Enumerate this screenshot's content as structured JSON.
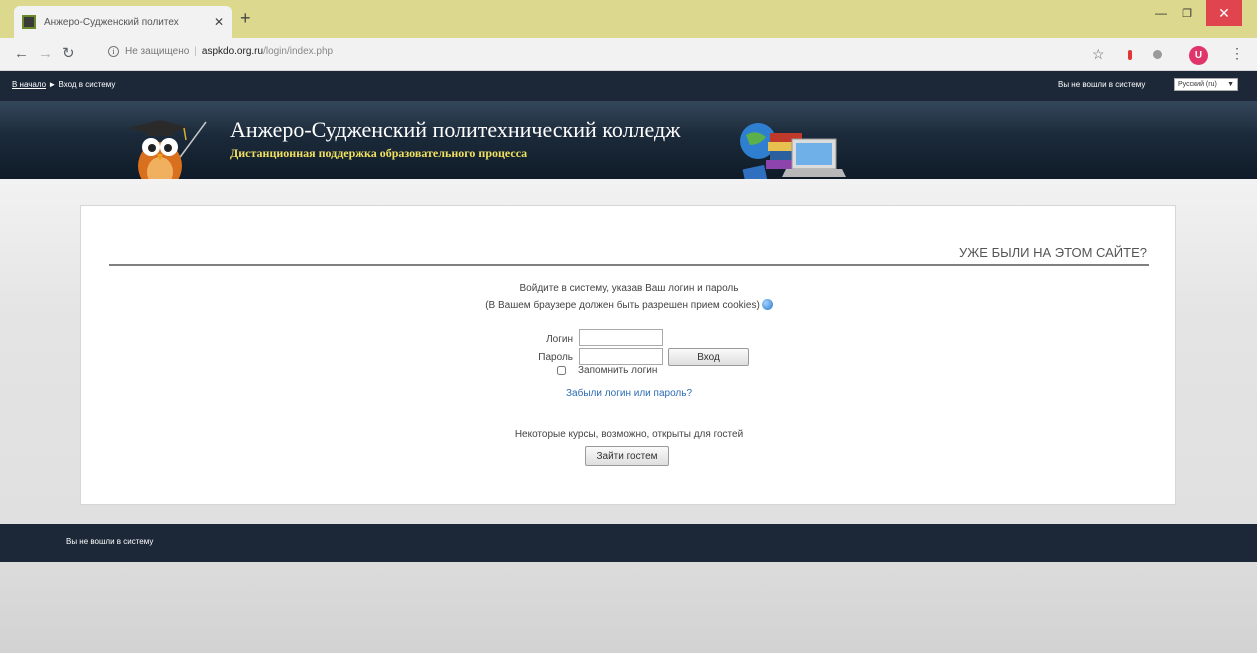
{
  "browser": {
    "tab_title": "Анжеро-Судженский политех",
    "new_tab": "+",
    "url_insecure": "Не защищено",
    "url_domain": "aspkdo.org.ru",
    "url_path": "/login/index.php",
    "profile_initial": "U"
  },
  "navbar": {
    "breadcrumb_home": "В начало",
    "breadcrumb_arrow": "►",
    "breadcrumb_current": "Вход в систему",
    "login_info": "Вы не вошли в систему",
    "language": "Русский (ru)"
  },
  "header": {
    "title": "Анжеро-Судженский политехнический колледж",
    "subtitle": "Дистанционная поддержка образовательного процесса"
  },
  "login": {
    "heading": "УЖЕ БЫЛИ НА ЭТОМ САЙТЕ?",
    "intro1": "Войдите в систему, указав Ваш логин и пароль",
    "intro2": "(В Вашем браузере должен быть разрешен прием cookies)",
    "username_label": "Логин",
    "username_value": "",
    "password_label": "Пароль",
    "password_value": "",
    "submit_label": "Вход",
    "remember_label": "Запомнить логин",
    "forgot_link": "Забыли логин или пароль?",
    "guest_text": "Некоторые курсы, возможно, открыты для гостей",
    "guest_button": "Зайти гостем"
  },
  "footer": {
    "login_info": "Вы не вошли в систему"
  },
  "colors": {
    "navbar_bg": "#1c2838",
    "tabbar_bg": "#dcd98f",
    "subtitle": "#f0e060",
    "link": "#2b6bb2"
  }
}
